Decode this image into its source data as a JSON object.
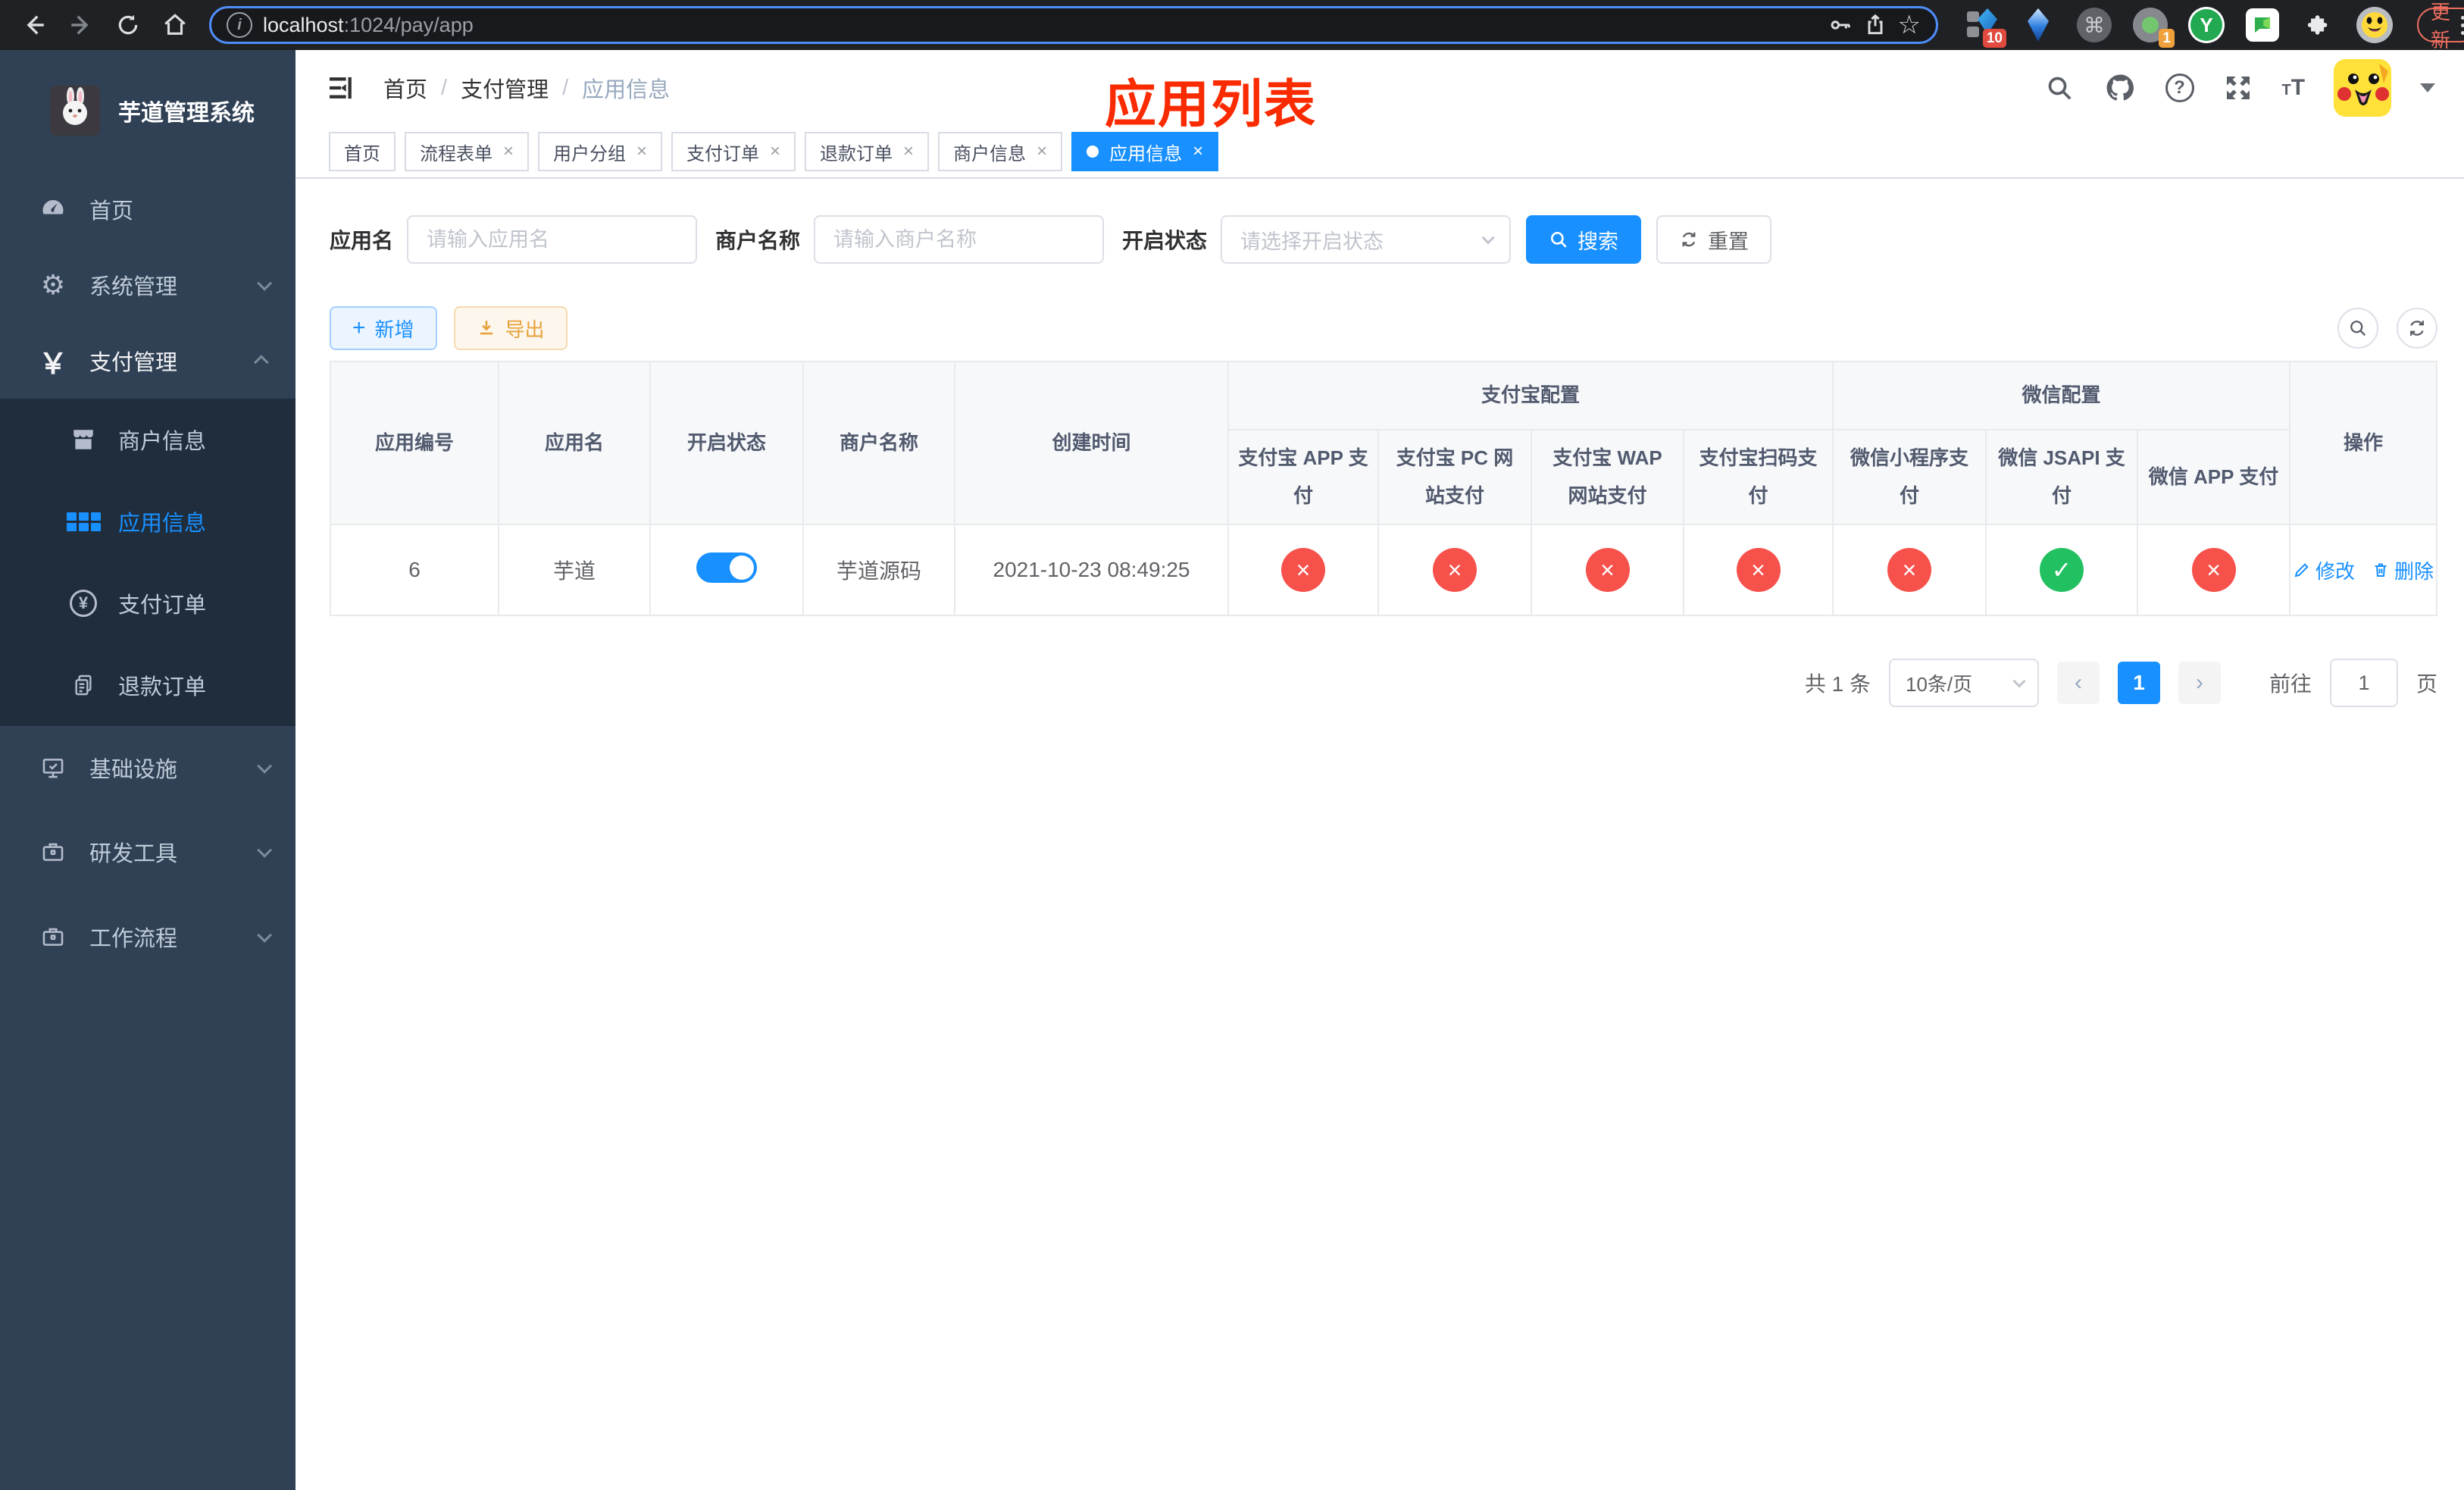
{
  "colors": {
    "primary": "#1890ff",
    "danger": "#f7514c",
    "success": "#21c161",
    "export_accent": "#e6a23c",
    "annotation_red": "#fa2b00",
    "sidebar_bg": "#304156",
    "submenu_bg": "#1f2d3d"
  },
  "browser": {
    "url_host": "localhost",
    "url_rest": ":1024/pay/app",
    "ext_badge_count": "10",
    "ext_badge_count2": "1",
    "update_label": "更新"
  },
  "sidebar": {
    "title": "芋道管理系统",
    "home": "首页",
    "system": "系统管理",
    "payment": "支付管理",
    "merchant_info": "商户信息",
    "app_info": "应用信息",
    "pay_order": "支付订单",
    "refund_order": "退款订单",
    "infrastructure": "基础设施",
    "dev_tools": "研发工具",
    "workflow": "工作流程"
  },
  "header": {
    "breadcrumb": [
      "首页",
      "支付管理",
      "应用信息"
    ],
    "annotation": "应用列表"
  },
  "tabs": [
    {
      "label": "首页"
    },
    {
      "label": "流程表单"
    },
    {
      "label": "用户分组"
    },
    {
      "label": "支付订单"
    },
    {
      "label": "退款订单"
    },
    {
      "label": "商户信息"
    },
    {
      "label": "应用信息"
    }
  ],
  "filters": {
    "app_name_label": "应用名",
    "app_name_placeholder": "请输入应用名",
    "merchant_label": "商户名称",
    "merchant_placeholder": "请输入商户名称",
    "status_label": "开启状态",
    "status_placeholder": "请选择开启状态",
    "search": "搜索",
    "reset": "重置"
  },
  "toolbar": {
    "add": "新增",
    "export": "导出"
  },
  "table": {
    "headers": {
      "app_id": "应用编号",
      "app_name": "应用名",
      "status": "开启状态",
      "merchant": "商户名称",
      "created": "创建时间",
      "alipay_group": "支付宝配置",
      "wechat_group": "微信配置",
      "alipay_app": "支付宝 APP 支付",
      "alipay_pc": "支付宝 PC 网站支付",
      "alipay_wap": "支付宝 WAP 网站支付",
      "alipay_qr": "支付宝扫码支付",
      "wx_lite": "微信小程序支付",
      "wx_jsapi": "微信 JSAPI 支付",
      "wx_app": "微信 APP 支付",
      "actions": "操作"
    },
    "row": {
      "app_id": "6",
      "app_name": "芋道",
      "status": "on",
      "merchant": "芋道源码",
      "created": "2021-10-23 08:49:25",
      "alipay_app": "disabled",
      "alipay_pc": "disabled",
      "alipay_wap": "disabled",
      "alipay_qr": "disabled",
      "wx_lite": "disabled",
      "wx_jsapi": "enabled",
      "wx_app": "disabled"
    },
    "edit": "修改",
    "delete": "删除"
  },
  "pagination": {
    "total": "共 1 条",
    "page_size": "10条/页",
    "page": "1",
    "goto": "前往",
    "goto_value": "1",
    "unit": "页"
  }
}
